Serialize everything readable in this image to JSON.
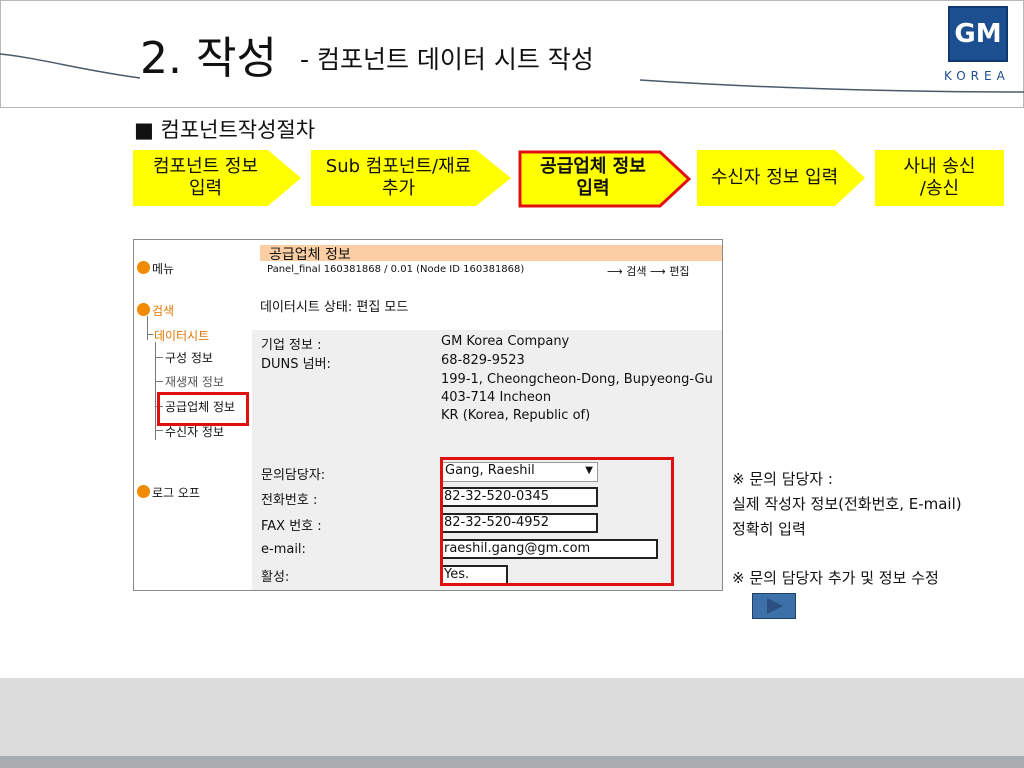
{
  "title": {
    "main": "2. 작성",
    "sub": "- 컴포넌트 데이터 시트 작성"
  },
  "logo": {
    "top": "GM",
    "bottom": "KOREA"
  },
  "section_heading": "■ 컴포넌트작성절차",
  "process_steps": [
    {
      "label": "컴포넌트 정보\n입력",
      "highlighted": false
    },
    {
      "label": "Sub 컴포넌트/재료\n추가",
      "highlighted": false
    },
    {
      "label": "공급업체 정보\n입력",
      "highlighted": true
    },
    {
      "label": "수신자 정보 입력",
      "highlighted": false
    },
    {
      "label": "사내 송신\n/송신",
      "highlighted": false
    }
  ],
  "colors": {
    "step_fill": "#ffff00",
    "highlight_border": "#e01010",
    "panel_header": "#fbcfa3",
    "nav_dot": "#f08a00"
  },
  "screenshot": {
    "nav": {
      "menu": "메뉴",
      "search": "검색",
      "datasheet": "데이터시트",
      "items": [
        "구성 정보",
        "재생재 정보",
        "공급업체 정보",
        "수신자 정보"
      ],
      "logoff": "로그 오프"
    },
    "panel_title": "공급업체 정보",
    "panel_meta": "Panel_final 160381868 / 0.01 (Node ID 160381868)",
    "links": {
      "search": "검색",
      "edit": "편집"
    },
    "status": "데이터시트 상태: 편집 모드",
    "company_label": "기업 정보 :",
    "duns_label": "DUNS 넘버:",
    "company_name": "GM Korea Company",
    "duns": "68-829-9523",
    "address1": "199-1, Cheongcheon-Dong, Bupyeong-Gu",
    "address2": "403-714 Incheon",
    "address3": "KR (Korea, Republic of)",
    "contact_label": "문의담당자:",
    "contact_value": "Gang, Raeshil",
    "phone_label": "전화번호 :",
    "phone_value": "82-32-520-0345",
    "fax_label": "FAX 번호 :",
    "fax_value": "82-32-520-4952",
    "email_label": "e-mail:",
    "email_value": "raeshil.gang@gm.com",
    "active_label": "활성:",
    "active_value": "Yes."
  },
  "notes": {
    "line1": "※ 문의 담당자 :",
    "line2": "실제 작성자 정보(전화번호, E-mail)",
    "line3": "정확히 입력",
    "line4": "※ 문의 담당자 추가 및 정보 수정"
  }
}
